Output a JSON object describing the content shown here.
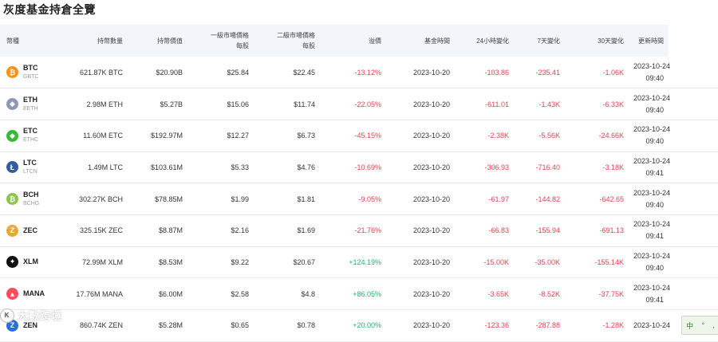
{
  "page": {
    "title": "灰度基金持倉全覽"
  },
  "table": {
    "headers": {
      "coin": "幣種",
      "holdings": "持幣數量",
      "value": "持幣價值",
      "primary_a": "一級市場價格",
      "primary_b": "每股",
      "secondary_a": "二級市場價格",
      "secondary_b": "每股",
      "premium": "溢價",
      "fund_time": "基金時間",
      "change24h": "24小時變化",
      "change7d": "7天變化",
      "change30d": "30天變化",
      "update_time": "更新時間"
    },
    "rows": [
      {
        "symbol": "BTC",
        "fund": "GBTC",
        "icon": "bitcoin-icon",
        "glyph": "₿",
        "color": "#f7931a",
        "holdings": "621.87K BTC",
        "value": "$20.90B",
        "primary": "$25.84",
        "secondary": "$22.45",
        "premium": "-13.12%",
        "fund_time": "2023-10-20",
        "c24": "-103.86",
        "c7": "-235.41",
        "c30": "-1.06K",
        "upd_date": "2023-10-24",
        "upd_time": "09:40"
      },
      {
        "symbol": "ETH",
        "fund": "EETH",
        "icon": "ethereum-icon",
        "glyph": "◆",
        "color": "#8f98b3",
        "holdings": "2.98M ETH",
        "value": "$5.27B",
        "primary": "$15.06",
        "secondary": "$11.74",
        "premium": "-22.05%",
        "fund_time": "2023-10-20",
        "c24": "-611.01",
        "c7": "-1.43K",
        "c30": "-6.33K",
        "upd_date": "2023-10-24",
        "upd_time": "09:40"
      },
      {
        "symbol": "ETC",
        "fund": "ETHC",
        "icon": "ethereum-classic-icon",
        "glyph": "◆",
        "color": "#3ab83a",
        "holdings": "11.60M ETC",
        "value": "$192.97M",
        "primary": "$12.27",
        "secondary": "$6.73",
        "premium": "-45.15%",
        "fund_time": "2023-10-20",
        "c24": "-2.38K",
        "c7": "-5.56K",
        "c30": "-24.66K",
        "upd_date": "2023-10-24",
        "upd_time": "09:40"
      },
      {
        "symbol": "LTC",
        "fund": "LTCN",
        "icon": "litecoin-icon",
        "glyph": "Ł",
        "color": "#345d9d",
        "holdings": "1.49M LTC",
        "value": "$103.61M",
        "primary": "$5.33",
        "secondary": "$4.76",
        "premium": "-10.69%",
        "fund_time": "2023-10-20",
        "c24": "-306.93",
        "c7": "-716.40",
        "c30": "-3.18K",
        "upd_date": "2023-10-24",
        "upd_time": "09:41"
      },
      {
        "symbol": "BCH",
        "fund": "BCHG",
        "icon": "bitcoin-cash-icon",
        "glyph": "₿",
        "color": "#8dc351",
        "holdings": "302.27K BCH",
        "value": "$78.85M",
        "primary": "$1.99",
        "secondary": "$1.81",
        "premium": "-9.05%",
        "fund_time": "2023-10-20",
        "c24": "-61.97",
        "c7": "-144.82",
        "c30": "-642.65",
        "upd_date": "2023-10-24",
        "upd_time": "09:40"
      },
      {
        "symbol": "ZEC",
        "fund": "",
        "icon": "zcash-icon",
        "glyph": "Z",
        "color": "#e5a93d",
        "holdings": "325.15K ZEC",
        "value": "$8.87M",
        "primary": "$2.16",
        "secondary": "$1.69",
        "premium": "-21.76%",
        "fund_time": "2023-10-20",
        "c24": "-66.83",
        "c7": "-155.94",
        "c30": "-691.13",
        "upd_date": "2023-10-24",
        "upd_time": "09:41"
      },
      {
        "symbol": "XLM",
        "fund": "",
        "icon": "stellar-icon",
        "glyph": "✦",
        "color": "#111111",
        "holdings": "72.99M XLM",
        "value": "$8.53M",
        "primary": "$9.22",
        "secondary": "$20.67",
        "premium": "+124.19%",
        "fund_time": "2023-10-20",
        "c24": "-15.00K",
        "c7": "-35.00K",
        "c30": "-155.14K",
        "upd_date": "2023-10-24",
        "upd_time": "09:40"
      },
      {
        "symbol": "MANA",
        "fund": "",
        "icon": "decentraland-icon",
        "glyph": "▲",
        "color": "#ff4d5e",
        "holdings": "17.76M MANA",
        "value": "$6.00M",
        "primary": "$2.58",
        "secondary": "$4.8",
        "premium": "+86.05%",
        "fund_time": "2023-10-20",
        "c24": "-3.65K",
        "c7": "-8.52K",
        "c30": "-37.75K",
        "upd_date": "2023-10-24",
        "upd_time": "09:41"
      },
      {
        "symbol": "ZEN",
        "fund": "",
        "icon": "horizen-icon",
        "glyph": "Z",
        "color": "#2a6fd6",
        "holdings": "860.74K ZEN",
        "value": "$5.28M",
        "primary": "$0.65",
        "secondary": "$0.78",
        "premium": "+20.00%",
        "fund_time": "2023-10-20",
        "c24": "-123.36",
        "c7": "-287.88",
        "c30": "-1.28K",
        "upd_date": "2023-10-24",
        "upd_time": ""
      }
    ]
  },
  "overlay": {
    "watermark_text": "大數跨境",
    "watermark_logo": "K",
    "ime_chars": [
      "中",
      "°",
      ","
    ]
  },
  "colors": {
    "negative": "#e04352",
    "positive": "#21b36b",
    "header_bg": "#f2f5fa"
  }
}
